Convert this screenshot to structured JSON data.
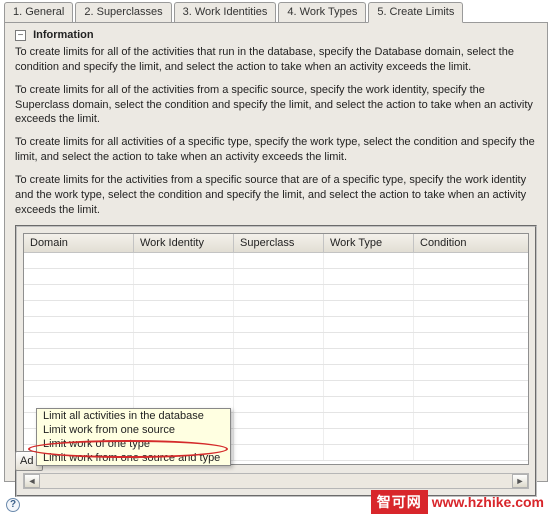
{
  "tabs": [
    {
      "label": "1. General"
    },
    {
      "label": "2. Superclasses"
    },
    {
      "label": "3. Work Identities"
    },
    {
      "label": "4. Work Types"
    },
    {
      "label": "5. Create Limits",
      "active": true
    }
  ],
  "info": {
    "title": "Information",
    "p1": "To create limits for all of the activities that run in the database, specify the Database domain, select the condition and specify the limit, and select the action to take when an activity exceeds the limit.",
    "p2": "To create limits for all of the activities from a specific source, specify the work identity, specify the Superclass domain, select the condition and specify the limit, and select the action to take when an activity exceeds the limit.",
    "p3": "To create limits for all activities of a specific type, specify the work type, select the condition and specify the limit, and select the action to take when an activity exceeds the limit.",
    "p4": "To create limits for the activities from a specific source that are of a specific type, specify the work identity and the work type, select the condition and specify the limit, and select the action to take when an activity exceeds the limit."
  },
  "grid": {
    "columns": [
      "Domain",
      "Work Identity",
      "Superclass",
      "Work Type",
      "Condition"
    ],
    "rows": 13
  },
  "add_button": "Ad",
  "popup": {
    "items": [
      "Limit all activities in the database",
      "Limit work from one source",
      "Limit work of one type",
      "Limit work from one source and type"
    ]
  },
  "watermark": {
    "badge": "智可网",
    "url": "www.hzhike.com"
  }
}
